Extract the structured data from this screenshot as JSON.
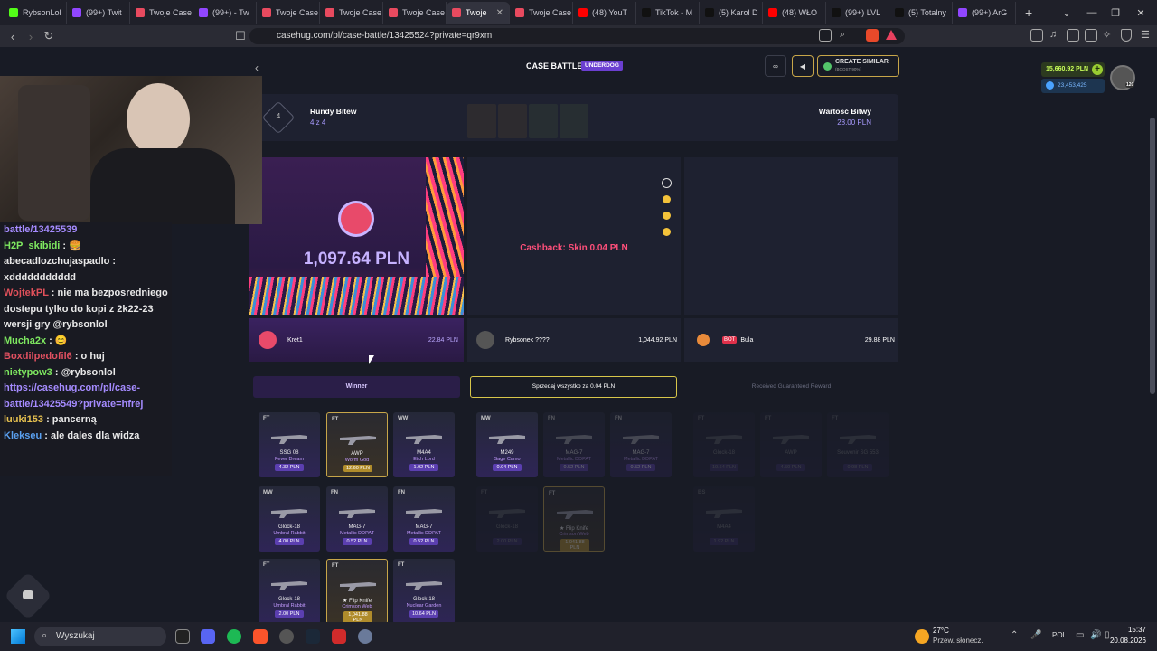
{
  "browser": {
    "tabs": [
      {
        "label": "RybsonLol",
        "color": "#53fc18",
        "active": false
      },
      {
        "label": "(99+) Twit",
        "color": "#9146ff",
        "active": false
      },
      {
        "label": "Twoje Case",
        "color": "#e84a5f",
        "active": false
      },
      {
        "label": "(99+) - Tw",
        "color": "#9146ff",
        "active": false
      },
      {
        "label": "Twoje Case",
        "color": "#e84a5f",
        "active": false
      },
      {
        "label": "Twoje Case",
        "color": "#e84a5f",
        "active": false
      },
      {
        "label": "Twoje Case",
        "color": "#e84a5f",
        "active": false
      },
      {
        "label": "Twoje",
        "color": "#e84a5f",
        "active": true
      },
      {
        "label": "Twoje Case",
        "color": "#e84a5f",
        "active": false
      },
      {
        "label": "(48) YouT",
        "color": "#ff0000",
        "active": false
      },
      {
        "label": "TikTok - M",
        "color": "#111111",
        "active": false
      },
      {
        "label": "(5) Karol D",
        "color": "#111111",
        "active": false
      },
      {
        "label": "(48) WŁO",
        "color": "#ff0000",
        "active": false
      },
      {
        "label": "(99+) LVL",
        "color": "#111111",
        "active": false
      },
      {
        "label": "(5) Totalny",
        "color": "#111111",
        "active": false
      },
      {
        "label": "(99+) ArG",
        "color": "#9146ff",
        "active": false
      }
    ],
    "url": "casehug.com/pl/case-battle/13425524?private=qr9xm"
  },
  "header": {
    "title": "CASE BATTLE",
    "badge": "UNDERDOG",
    "create_similar": "CREATE SIMILAR",
    "create_similar_sub": "(BOOST 90%)",
    "balance": "15,660.92 PLN",
    "points": "23,453,425",
    "level": "120"
  },
  "battle_info": {
    "rounds_count": "4",
    "rounds_label": "Rundy Bitew",
    "rounds_value": "4 z 4",
    "value_label": "Wartość Bitwy",
    "value": "28.00 PLN"
  },
  "winner_panel": {
    "amount": "1,097.64 PLN"
  },
  "middle_panel": {
    "cashback": "Cashback: Skin 0.04 PLN"
  },
  "players": [
    {
      "name": "Kret1",
      "total": "22.84 PLN"
    },
    {
      "name": "Rybsonek ????",
      "total": "1,044.92 PLN"
    },
    {
      "name": "Bula",
      "bot": "BOT",
      "total": "29.88 PLN"
    }
  ],
  "actions": {
    "winner": "Winner",
    "sell_all": "Sprzedaj wszystko za 0.04 PLN",
    "guaranteed": "Received Guaranteed Reward"
  },
  "col1_items": [
    {
      "cond": "FT",
      "name": "SSG 08",
      "skin": "Fever Dream",
      "price": "4.32 PLN"
    },
    {
      "cond": "FT",
      "name": "AWP",
      "skin": "Worm God",
      "price": "12.60 PLN"
    },
    {
      "cond": "WW",
      "name": "M4A4",
      "skin": "Etch Lord",
      "price": "1.92 PLN"
    },
    {
      "cond": "MW",
      "name": "Glock-18",
      "skin": "Umbral Rabbit",
      "price": "4.00 PLN"
    },
    {
      "cond": "FN",
      "name": "MAG-7",
      "skin": "Metallic DDPAT",
      "price": "0.52 PLN"
    },
    {
      "cond": "FN",
      "name": "MAG-7",
      "skin": "Metallic DDPAT",
      "price": "0.52 PLN"
    },
    {
      "cond": "FT",
      "name": "Glock-18",
      "skin": "Umbral Rabbit",
      "price": "2.00 PLN"
    },
    {
      "cond": "FT",
      "name": "★ Flip Knife",
      "skin": "Crimson Web",
      "price": "1,041.88 PLN"
    },
    {
      "cond": "FT",
      "name": "Glock-18",
      "skin": "Nuclear Garden",
      "price": "10.64 PLN"
    }
  ],
  "col2_items": [
    {
      "cond": "MW",
      "name": "M249",
      "skin": "Sage Camo",
      "price": "0.04 PLN"
    },
    {
      "cond": "FN",
      "name": "MAG-7",
      "skin": "Metallic DDPAT",
      "price": "0.52 PLN"
    },
    {
      "cond": "FN",
      "name": "MAG-7",
      "skin": "Metallic DDPAT",
      "price": "0.52 PLN"
    },
    {
      "cond": "FT",
      "name": "Glock-18",
      "skin": "",
      "price": "2.00 PLN"
    },
    {
      "cond": "FT",
      "name": "★ Flip Knife",
      "skin": "Crimson Web",
      "price": "1,041.88 PLN"
    }
  ],
  "col3_items": [
    {
      "cond": "FT",
      "name": "Glock-18",
      "skin": "",
      "price": "10.64 PLN"
    },
    {
      "cond": "FT",
      "name": "AWP",
      "skin": "",
      "price": "4.50 PLN"
    },
    {
      "cond": "FT",
      "name": "Souvenir SG 553",
      "skin": "",
      "price": "0.98 PLN"
    },
    {
      "cond": "BS",
      "name": "M4A4",
      "skin": "",
      "price": "1.92 PLN"
    }
  ],
  "stream": {
    "chat": [
      {
        "user": "",
        "text": "battle/13425539",
        "link": true
      },
      {
        "user": "H2P_skibidi",
        "color": "#7ee860",
        "text": " : 🍔"
      },
      {
        "user": "",
        "text": "abecadlozchujaspadlo :"
      },
      {
        "user": "",
        "text": "xddddddddddd"
      },
      {
        "user": "WojtekPL",
        "color": "#e0505a",
        "text": " : nie ma bezposredniego"
      },
      {
        "user": "",
        "text": "dostepu tylko do kopi z 2k22-23"
      },
      {
        "user": "",
        "text": "wersji gry @rybsonlol"
      },
      {
        "user": "Mucha2x",
        "color": "#7ee860",
        "text": " : 😊"
      },
      {
        "user": "Boxdilpedofil6",
        "color": "#e05060",
        "text": " : o huj"
      },
      {
        "user": "nietypow3",
        "color": "#7ee860",
        "text": " : @rybsonlol"
      },
      {
        "user": "",
        "text": "https://casehug.com/pl/case-",
        "link": true
      },
      {
        "user": "",
        "text": "battle/13425549?private=hfrej",
        "link": true
      },
      {
        "user": "luuki153",
        "color": "#e8c250",
        "text": " : pancerną"
      },
      {
        "user": "Klekseu",
        "color": "#5aa0f0",
        "text": " : ale dales dla widza"
      }
    ]
  },
  "taskbar": {
    "search": "Wyszukaj",
    "weather_temp": "27°C",
    "weather_desc": "Przew. słonecz.",
    "lang": "POL",
    "time": "15:37",
    "date": "20.08.2026"
  }
}
